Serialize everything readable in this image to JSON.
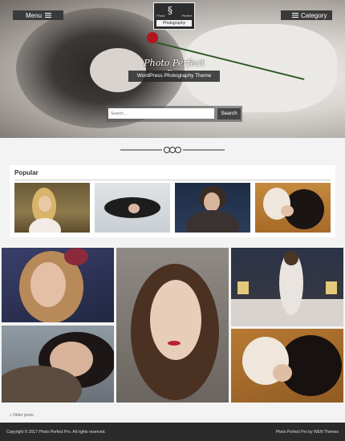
{
  "header": {
    "menu_label": "Menu",
    "category_label": "Category",
    "logo": {
      "top_left": "Photo",
      "top_right": "Perfect",
      "banner": "Photography"
    },
    "site_title": "Photo Perfect Pro",
    "tagline": "WordPress Photography Theme",
    "search": {
      "placeholder": "Search...",
      "button_label": "Search"
    }
  },
  "popular": {
    "heading": "Popular",
    "items": [
      {
        "alt": "Woman with long hair in field"
      },
      {
        "alt": "Woman lying in snow"
      },
      {
        "alt": "Woman with fur collar"
      },
      {
        "alt": "Woman lying with hair spread"
      }
    ]
  },
  "gallery": [
    {
      "alt": "Woman with roses in hair"
    },
    {
      "alt": "Woman portrait close-up"
    },
    {
      "alt": "Woman on bed"
    },
    {
      "alt": "Woman in fur coat"
    },
    {
      "alt": "Woman reclining"
    }
  ],
  "pagination": {
    "older": "« Older posts"
  },
  "footer": {
    "copyright": "Copyright © 2017 Photo Perfect Pro. All rights reserved.",
    "credit": "Photo Perfect Pro by WEN Themes"
  }
}
